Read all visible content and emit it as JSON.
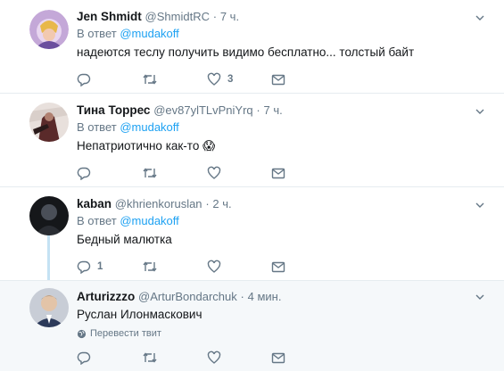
{
  "tweets": [
    {
      "fullname": "Jen Shmidt",
      "handle": "@ShmidtRC",
      "dot": "·",
      "time": "7 ч.",
      "reply_prefix": "В ответ",
      "reply_user": "@mudakoff",
      "text": "надеются теслу получить видимо бесплатно... толстый байт",
      "replies": "",
      "retweets": "",
      "likes": "3",
      "avatar_colors": [
        "#c4a8d8",
        "#e8b84a",
        "#6b4f9e"
      ]
    },
    {
      "fullname": "Тина Торрес",
      "handle": "@ev87ylTLvPniYrq",
      "dot": "·",
      "time": "7 ч.",
      "reply_prefix": "В ответ",
      "reply_user": "@mudakoff",
      "text": "Непатриотично как-то 😱",
      "replies": "",
      "retweets": "",
      "likes": "",
      "avatar_colors": [
        "#e8e0dc",
        "#5a2a2a",
        "#b08070"
      ]
    },
    {
      "fullname": "kaban",
      "handle": "@khrienkoruslan",
      "dot": "·",
      "time": "2 ч.",
      "reply_prefix": "В ответ",
      "reply_user": "@mudakoff",
      "text": "Бедный малютка",
      "replies": "1",
      "retweets": "",
      "likes": "",
      "avatar_colors": [
        "#2a2d33",
        "#4a4f58",
        "#15171a"
      ]
    },
    {
      "fullname": "Arturizzzo",
      "handle": "@ArturBondarchuk",
      "dot": "·",
      "time": "4 мин.",
      "text": "Руслан Илонмаскович",
      "translate": "Перевести твит",
      "replies": "",
      "retweets": "",
      "likes": "",
      "avatar_colors": [
        "#c8cdd6",
        "#e3c4a8",
        "#2c3a5a"
      ]
    }
  ],
  "colors": {
    "link": "#1da1f2",
    "muted": "#657786",
    "thread": "#c4e2f3",
    "highlight_bg": "#f5f8fa"
  }
}
